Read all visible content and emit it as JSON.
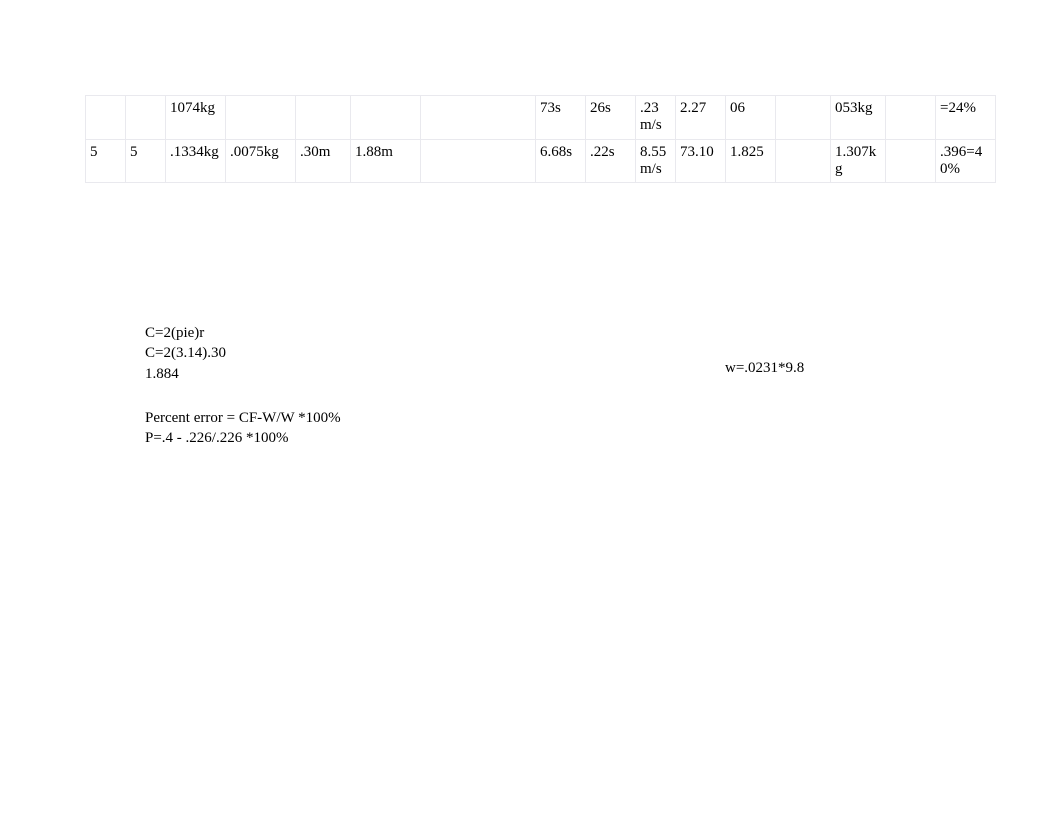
{
  "table": {
    "rows": [
      [
        "",
        "",
        "1074kg",
        "",
        "",
        "",
        "",
        "73s",
        "26s",
        ".23m/s",
        "2.27",
        "06",
        "",
        "053kg",
        "",
        "=24%"
      ],
      [
        "5",
        "5",
        ".1334kg",
        ".0075kg",
        ".30m",
        "1.88m",
        "",
        "6.68s",
        ".22s",
        "8.55m/s",
        "73.10",
        "1.825",
        "",
        "1.307kg",
        "",
        ".396=40%"
      ]
    ]
  },
  "notes": {
    "line1": "C=2(pie)r",
    "line2": "C=2(3.14).30",
    "line3": "1.884",
    "line4": "Percent error = CF-W/W             *100%",
    "line5": "P=.4 - .226/.226 *100%",
    "right": "w=.0231*9.8"
  }
}
